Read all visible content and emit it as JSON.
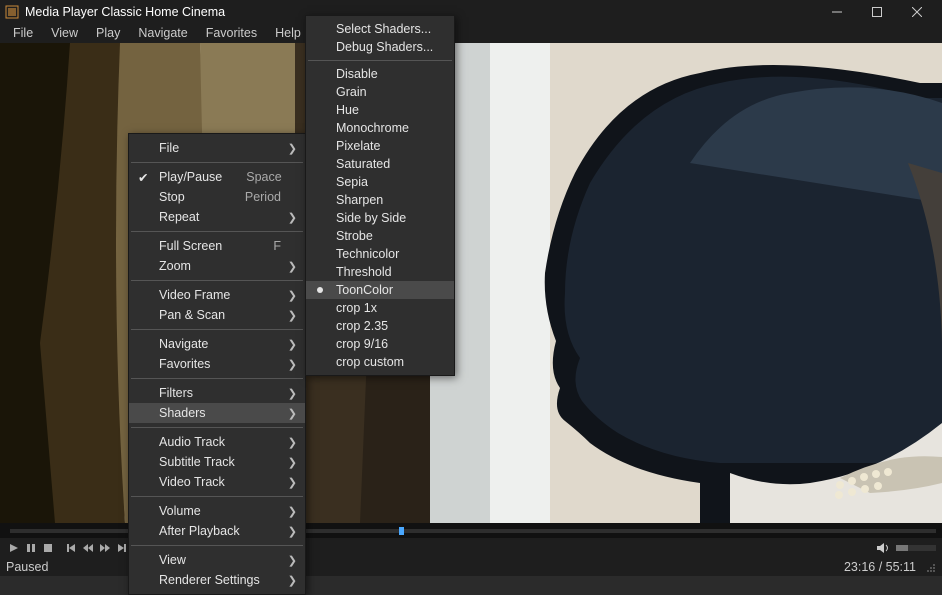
{
  "window": {
    "title": "Media Player Classic Home Cinema",
    "buttons": {
      "min": "—",
      "max": "▢",
      "close": "✕"
    }
  },
  "menubar": [
    "File",
    "View",
    "Play",
    "Navigate",
    "Favorites",
    "Help"
  ],
  "ctx1": {
    "items": [
      {
        "label": "File",
        "arrow": true
      },
      "sep",
      {
        "label": "Play/Pause",
        "accel": "Space",
        "check": true
      },
      {
        "label": "Stop",
        "accel": "Period"
      },
      {
        "label": "Repeat",
        "arrow": true
      },
      "sep",
      {
        "label": "Full Screen",
        "accel": "F"
      },
      {
        "label": "Zoom",
        "arrow": true
      },
      "sep",
      {
        "label": "Video Frame",
        "arrow": true
      },
      {
        "label": "Pan & Scan",
        "arrow": true
      },
      "sep",
      {
        "label": "Navigate",
        "arrow": true
      },
      {
        "label": "Favorites",
        "arrow": true
      },
      "sep",
      {
        "label": "Filters",
        "arrow": true
      },
      {
        "label": "Shaders",
        "arrow": true,
        "hi": true
      },
      "sep",
      {
        "label": "Audio Track",
        "arrow": true
      },
      {
        "label": "Subtitle Track",
        "arrow": true
      },
      {
        "label": "Video Track",
        "arrow": true
      },
      "sep",
      {
        "label": "Volume",
        "arrow": true
      },
      {
        "label": "After Playback",
        "arrow": true
      },
      "sep",
      {
        "label": "View",
        "arrow": true
      },
      {
        "label": "Renderer Settings",
        "arrow": true
      }
    ]
  },
  "ctx2": {
    "items": [
      {
        "label": "Select Shaders..."
      },
      {
        "label": "Debug Shaders..."
      },
      "sep",
      {
        "label": " Disable"
      },
      {
        "label": "Grain"
      },
      {
        "label": "Hue"
      },
      {
        "label": "Monochrome"
      },
      {
        "label": "Pixelate"
      },
      {
        "label": "Saturated"
      },
      {
        "label": "Sepia"
      },
      {
        "label": "Sharpen"
      },
      {
        "label": "Side by Side"
      },
      {
        "label": "Strobe"
      },
      {
        "label": "Technicolor"
      },
      {
        "label": "Threshold"
      },
      {
        "label": "ToonColor",
        "hi": true,
        "bullet": true
      },
      {
        "label": "crop 1x"
      },
      {
        "label": "crop 2.35"
      },
      {
        "label": "crop 9/16"
      },
      {
        "label": "crop custom"
      }
    ]
  },
  "status": {
    "state": "Paused",
    "time": "23:16 / 55:11"
  },
  "icons": {
    "mute": "🔇",
    "speaker": "🔈"
  }
}
